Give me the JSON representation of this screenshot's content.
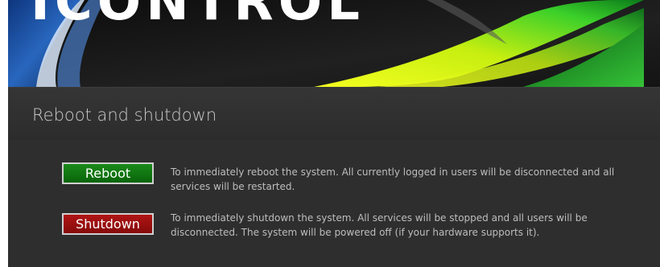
{
  "banner": {
    "logo_text": "ICONTROL"
  },
  "section": {
    "title": "Reboot and shutdown"
  },
  "actions": {
    "reboot": {
      "label": "Reboot",
      "description": "To immediately reboot the system. All currently logged in users will be disconnected and all services will be restarted.",
      "color": "#0b6e0b"
    },
    "shutdown": {
      "label": "Shutdown",
      "description": "To immediately shutdown the system. All services will be stopped and all users will be disconnected. The system will be powered off (if your hardware supports it).",
      "color": "#9a0f0f"
    }
  },
  "colors": {
    "background": "#2a2a2a",
    "text": "#bdbdbd",
    "accent_yellow": "#e8f000",
    "accent_green": "#2fd02f",
    "accent_blue": "#1c4fa8"
  }
}
